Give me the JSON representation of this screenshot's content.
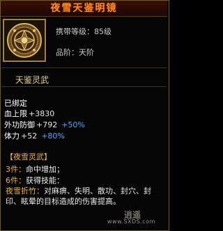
{
  "title": "夜雪天鉴明镜",
  "item": {
    "icon": "bronze-mirror-icon",
    "level_label": "携带等级：85级",
    "grade_label": "品阶：天阶"
  },
  "subtitle": "天鉴灵武",
  "bound": "已绑定",
  "stats": [
    {
      "label": "血上限",
      "value": "+3830",
      "bonus": ""
    },
    {
      "label": "外功防御",
      "value": "+792",
      "bonus": "+50%"
    },
    {
      "label": "体力",
      "value": "+52",
      "bonus": "+80%"
    }
  ],
  "set": {
    "name": "【夜雪灵武】",
    "piece3_key": "3件：",
    "piece3_val": "命中增加；",
    "piece6_key": "6件：",
    "piece6_val": "获得技能：",
    "skill_key": "夜雪折竹：",
    "skill_desc": "对麻痹、失明、散功、封穴、封印、眩晕的目标造成的伤害提高。"
  },
  "watermark": {
    "url": "www.SXDS.com",
    "logo": "逍遥"
  },
  "colors": {
    "title": "#ff8a1e",
    "set_name": "#f3b335",
    "bonus": "#56a7ff"
  }
}
